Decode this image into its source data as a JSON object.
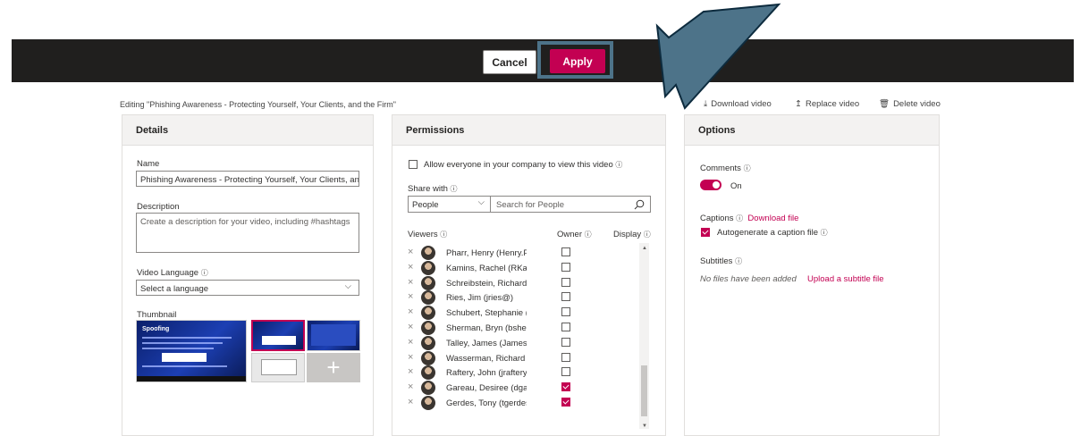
{
  "toolbar": {
    "cancel_label": "Cancel",
    "apply_label": "Apply"
  },
  "editing_text": "Editing \"Phishing Awareness - Protecting Yourself, Your Clients, and the Firm\"",
  "actions": {
    "download": "Download video",
    "replace": "Replace video",
    "delete": "Delete video"
  },
  "details": {
    "title": "Details",
    "name_label": "Name",
    "name_value": "Phishing Awareness - Protecting Yourself, Your Clients, and",
    "description_label": "Description",
    "description_placeholder": "Create a description for your video, including #hashtags",
    "language_label": "Video Language",
    "language_value": "Select a language",
    "thumbnail_label": "Thumbnail",
    "thumbnail_title": "Spoofing",
    "add_thumbnail_glyph": "+"
  },
  "permissions": {
    "title": "Permissions",
    "allow_label": "Allow everyone in your company to view this video",
    "share_with_label": "Share with",
    "share_type": "People",
    "search_placeholder": "Search for People",
    "viewers_label": "Viewers",
    "owner_label": "Owner",
    "display_label": "Display",
    "viewers": [
      {
        "name": "Pharr, Henry (Henry.Pha...",
        "owner": false
      },
      {
        "name": "Kamins, Rachel (RKamin...",
        "owner": false
      },
      {
        "name": "Schreibstein, Richard (rs...",
        "owner": false
      },
      {
        "name": "Ries, Jim (jries@)",
        "owner": false
      },
      {
        "name": "Schubert, Stephanie (ssc...",
        "owner": false
      },
      {
        "name": "Sherman, Bryn (bsherma...",
        "owner": false
      },
      {
        "name": "Talley, James (James.tall...",
        "owner": false
      },
      {
        "name": "Wasserman, Richard (rw...",
        "owner": false
      },
      {
        "name": "Raftery, John (jraftery@)",
        "owner": false
      },
      {
        "name": "Gareau, Desiree (dgarea...",
        "owner": true
      },
      {
        "name": "Gerdes, Tony (tgerdes@)",
        "owner": true
      }
    ]
  },
  "options": {
    "title": "Options",
    "comments_label": "Comments",
    "comments_state": "On",
    "captions_label": "Captions",
    "download_file": "Download file",
    "autogenerate_label": "Autogenerate a caption file",
    "subtitles_label": "Subtitles",
    "no_files": "No files have been added",
    "upload_subtitle": "Upload a subtitle file"
  },
  "icons": {
    "info": "ⓘ",
    "chevron": "⌵",
    "close": "×"
  },
  "colors": {
    "accent": "#c30052",
    "topbar": "#201f1e",
    "highlight": "#4d7389"
  }
}
